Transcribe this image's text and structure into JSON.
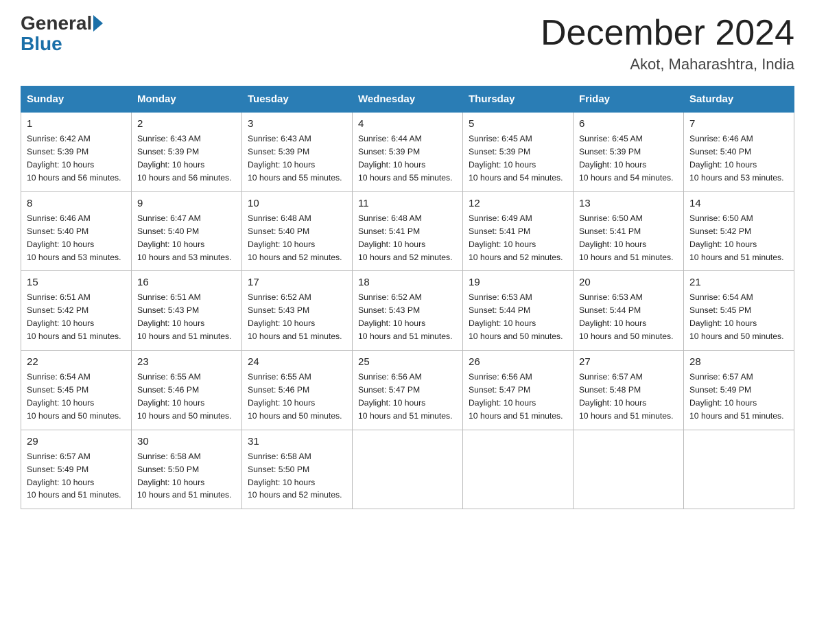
{
  "header": {
    "logo_general": "General",
    "logo_blue": "Blue",
    "title": "December 2024",
    "location": "Akot, Maharashtra, India"
  },
  "days_of_week": [
    "Sunday",
    "Monday",
    "Tuesday",
    "Wednesday",
    "Thursday",
    "Friday",
    "Saturday"
  ],
  "weeks": [
    [
      {
        "day": "1",
        "sunrise": "6:42 AM",
        "sunset": "5:39 PM",
        "daylight": "10 hours and 56 minutes."
      },
      {
        "day": "2",
        "sunrise": "6:43 AM",
        "sunset": "5:39 PM",
        "daylight": "10 hours and 56 minutes."
      },
      {
        "day": "3",
        "sunrise": "6:43 AM",
        "sunset": "5:39 PM",
        "daylight": "10 hours and 55 minutes."
      },
      {
        "day": "4",
        "sunrise": "6:44 AM",
        "sunset": "5:39 PM",
        "daylight": "10 hours and 55 minutes."
      },
      {
        "day": "5",
        "sunrise": "6:45 AM",
        "sunset": "5:39 PM",
        "daylight": "10 hours and 54 minutes."
      },
      {
        "day": "6",
        "sunrise": "6:45 AM",
        "sunset": "5:39 PM",
        "daylight": "10 hours and 54 minutes."
      },
      {
        "day": "7",
        "sunrise": "6:46 AM",
        "sunset": "5:40 PM",
        "daylight": "10 hours and 53 minutes."
      }
    ],
    [
      {
        "day": "8",
        "sunrise": "6:46 AM",
        "sunset": "5:40 PM",
        "daylight": "10 hours and 53 minutes."
      },
      {
        "day": "9",
        "sunrise": "6:47 AM",
        "sunset": "5:40 PM",
        "daylight": "10 hours and 53 minutes."
      },
      {
        "day": "10",
        "sunrise": "6:48 AM",
        "sunset": "5:40 PM",
        "daylight": "10 hours and 52 minutes."
      },
      {
        "day": "11",
        "sunrise": "6:48 AM",
        "sunset": "5:41 PM",
        "daylight": "10 hours and 52 minutes."
      },
      {
        "day": "12",
        "sunrise": "6:49 AM",
        "sunset": "5:41 PM",
        "daylight": "10 hours and 52 minutes."
      },
      {
        "day": "13",
        "sunrise": "6:50 AM",
        "sunset": "5:41 PM",
        "daylight": "10 hours and 51 minutes."
      },
      {
        "day": "14",
        "sunrise": "6:50 AM",
        "sunset": "5:42 PM",
        "daylight": "10 hours and 51 minutes."
      }
    ],
    [
      {
        "day": "15",
        "sunrise": "6:51 AM",
        "sunset": "5:42 PM",
        "daylight": "10 hours and 51 minutes."
      },
      {
        "day": "16",
        "sunrise": "6:51 AM",
        "sunset": "5:43 PM",
        "daylight": "10 hours and 51 minutes."
      },
      {
        "day": "17",
        "sunrise": "6:52 AM",
        "sunset": "5:43 PM",
        "daylight": "10 hours and 51 minutes."
      },
      {
        "day": "18",
        "sunrise": "6:52 AM",
        "sunset": "5:43 PM",
        "daylight": "10 hours and 51 minutes."
      },
      {
        "day": "19",
        "sunrise": "6:53 AM",
        "sunset": "5:44 PM",
        "daylight": "10 hours and 50 minutes."
      },
      {
        "day": "20",
        "sunrise": "6:53 AM",
        "sunset": "5:44 PM",
        "daylight": "10 hours and 50 minutes."
      },
      {
        "day": "21",
        "sunrise": "6:54 AM",
        "sunset": "5:45 PM",
        "daylight": "10 hours and 50 minutes."
      }
    ],
    [
      {
        "day": "22",
        "sunrise": "6:54 AM",
        "sunset": "5:45 PM",
        "daylight": "10 hours and 50 minutes."
      },
      {
        "day": "23",
        "sunrise": "6:55 AM",
        "sunset": "5:46 PM",
        "daylight": "10 hours and 50 minutes."
      },
      {
        "day": "24",
        "sunrise": "6:55 AM",
        "sunset": "5:46 PM",
        "daylight": "10 hours and 50 minutes."
      },
      {
        "day": "25",
        "sunrise": "6:56 AM",
        "sunset": "5:47 PM",
        "daylight": "10 hours and 51 minutes."
      },
      {
        "day": "26",
        "sunrise": "6:56 AM",
        "sunset": "5:47 PM",
        "daylight": "10 hours and 51 minutes."
      },
      {
        "day": "27",
        "sunrise": "6:57 AM",
        "sunset": "5:48 PM",
        "daylight": "10 hours and 51 minutes."
      },
      {
        "day": "28",
        "sunrise": "6:57 AM",
        "sunset": "5:49 PM",
        "daylight": "10 hours and 51 minutes."
      }
    ],
    [
      {
        "day": "29",
        "sunrise": "6:57 AM",
        "sunset": "5:49 PM",
        "daylight": "10 hours and 51 minutes."
      },
      {
        "day": "30",
        "sunrise": "6:58 AM",
        "sunset": "5:50 PM",
        "daylight": "10 hours and 51 minutes."
      },
      {
        "day": "31",
        "sunrise": "6:58 AM",
        "sunset": "5:50 PM",
        "daylight": "10 hours and 52 minutes."
      },
      null,
      null,
      null,
      null
    ]
  ]
}
